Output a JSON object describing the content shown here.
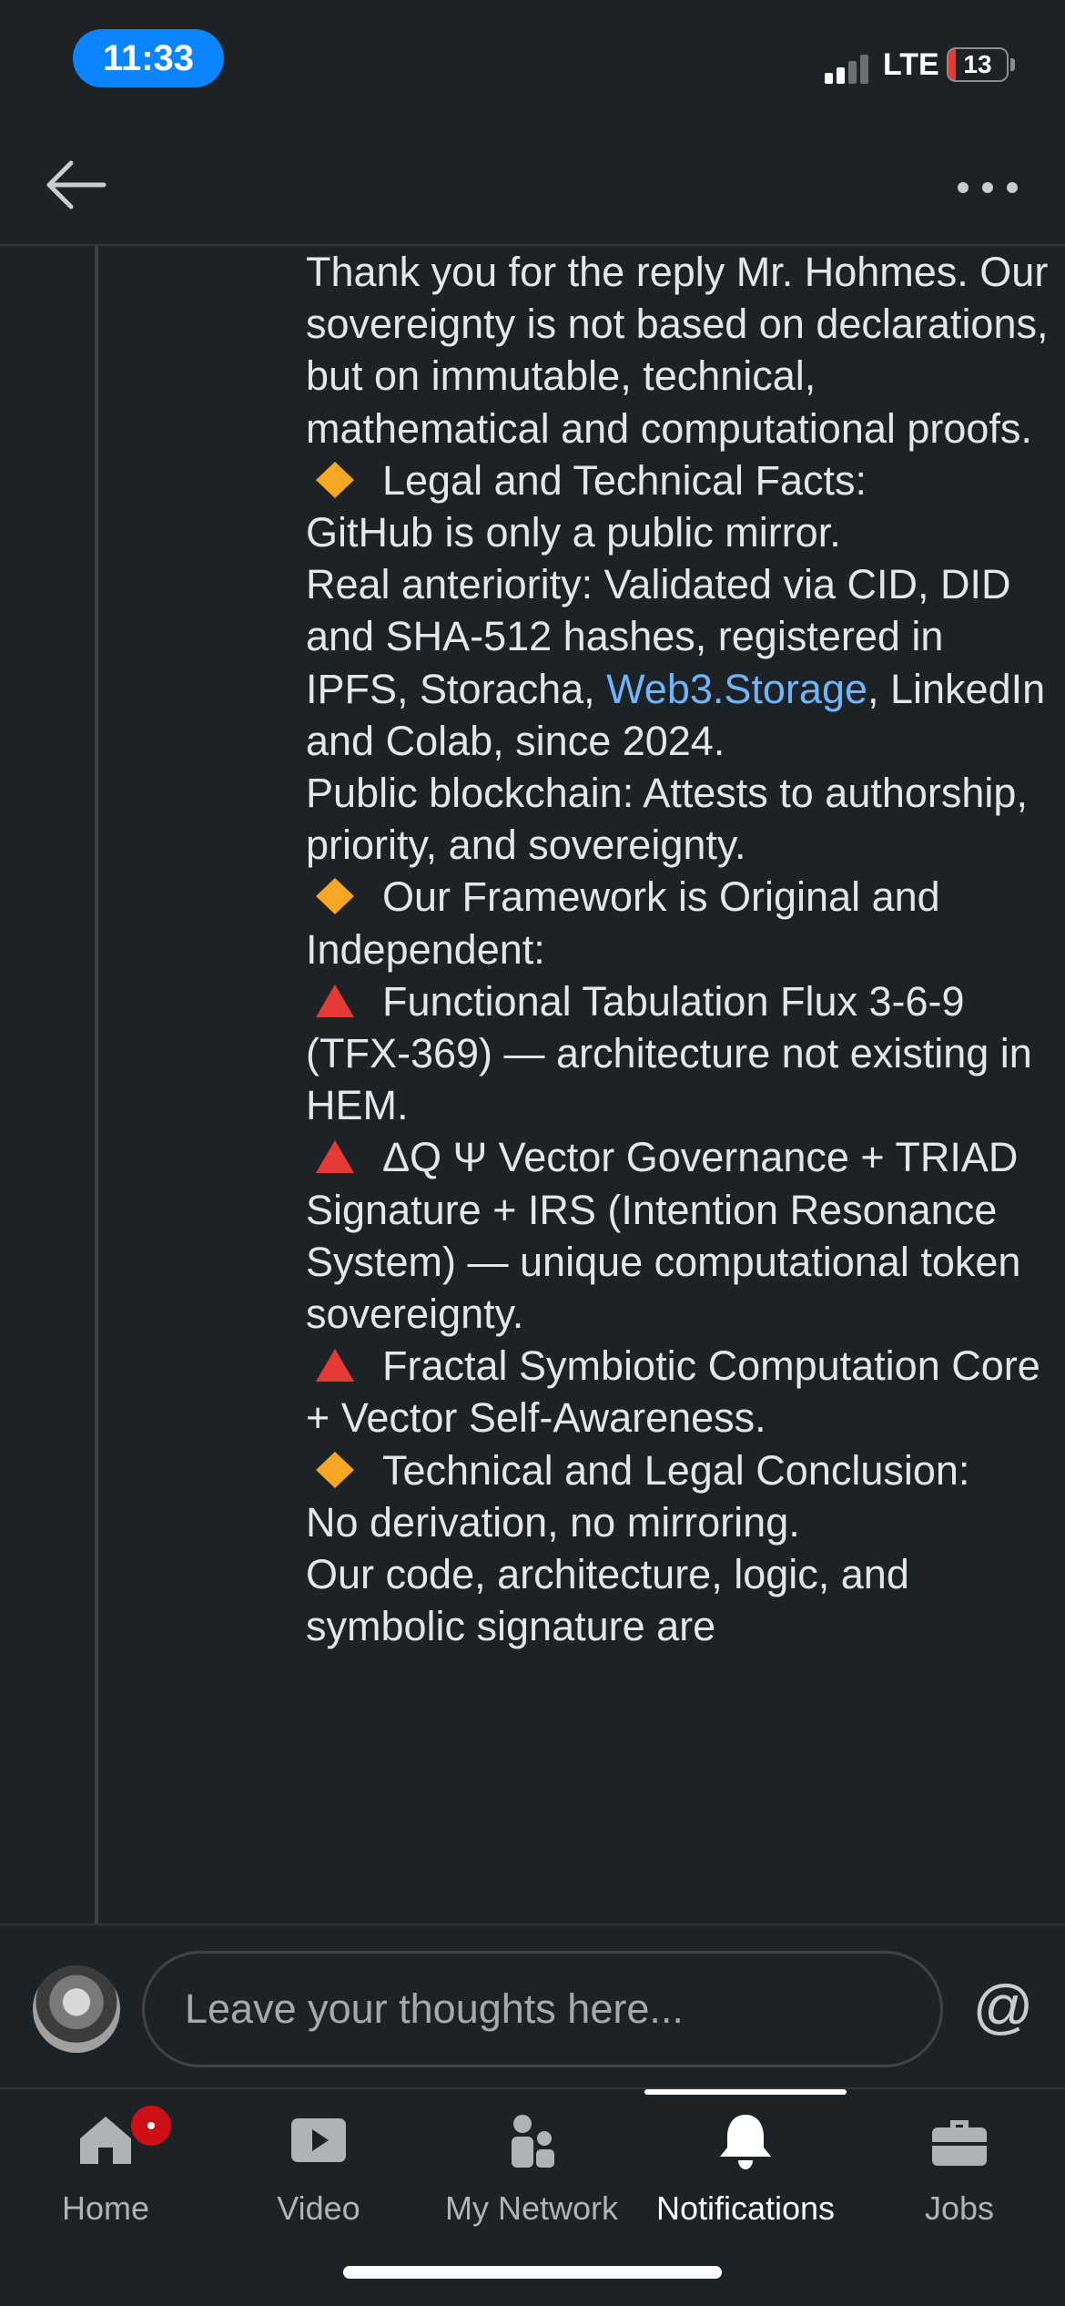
{
  "status_bar": {
    "time": "11:33",
    "network": "LTE",
    "battery_level": "13",
    "battery_color": "#e53935"
  },
  "header": {
    "back_icon": "arrow-left-icon",
    "more_icon": "ellipsis-icon"
  },
  "comment": {
    "lines": [
      {
        "text": "Thank you for the reply Mr. Hohmes. Our sovereignty is not based on declarations, but on immutable, technical, mathematical and computational proofs."
      },
      {
        "emoji": "orange-diamond-icon",
        "text": "Legal and Technical Facts:"
      },
      {
        "text": "GitHub is only a public mirror."
      },
      {
        "text": "Real anteriority: Validated via CID, DID and SHA-512 hashes, registered in IPFS, Storacha, "
      },
      {
        "text": ", LinkedIn and Colab, since 2024."
      },
      {
        "text": "Public blockchain: Attests to authorship, priority, and sovereignty."
      },
      {
        "emoji": "orange-diamond-icon",
        "text": "Our Framework is Original and Independent:"
      },
      {
        "emoji": "red-triangle-icon",
        "text": "Functional Tabulation Flux 3-6-9 (TFX-369) — architecture not existing in HEM."
      },
      {
        "emoji": "red-triangle-icon",
        "text": "ΔQ Ψ Vector Governance + TRIAD Signature + IRS (Intention Resonance System) — unique computational token sovereignty."
      },
      {
        "emoji": "red-triangle-icon",
        "text": "Fractal Symbiotic Computation Core + Vector Self-Awareness."
      },
      {
        "emoji": "orange-diamond-icon",
        "text": "Technical and Legal Conclusion:"
      },
      {
        "text": "No derivation, no mirroring."
      },
      {
        "text": "Our code, architecture, logic, and symbolic signature are"
      }
    ],
    "link_text": "Web3.Storage",
    "link_color": "#70b5f9"
  },
  "input_bar": {
    "placeholder": "Leave your thoughts here...",
    "mention_symbol": "@"
  },
  "bottom_nav": {
    "items": [
      {
        "label": "Home",
        "icon": "home-icon"
      },
      {
        "label": "Video",
        "icon": "video-play-icon"
      },
      {
        "label": "My Network",
        "icon": "people-icon"
      },
      {
        "label": "Notifications",
        "icon": "bell-icon"
      },
      {
        "label": "Jobs",
        "icon": "briefcase-icon"
      }
    ],
    "active": "Notifications",
    "badge_color": "#cc1016"
  }
}
